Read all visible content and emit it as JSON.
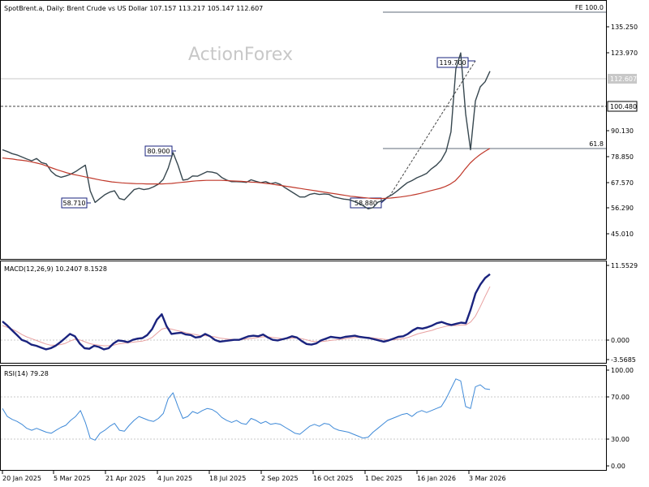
{
  "header": {
    "symbol": "SpotBrent.a",
    "timeframe": "Daily",
    "description": "Brent Crude vs US Dollar",
    "ohlc": "107.157 113.217 105.147 112.607"
  },
  "watermark": "ActionForex",
  "colors": {
    "price": "#37474f",
    "ma": "#c0392b",
    "macd": "#1a237e",
    "signal": "#e8a0a0",
    "rsi": "#3f8ad8",
    "fibo": "#5f6b7a",
    "grid": "#c8c8c8",
    "border": "#000000"
  },
  "chart_data": [
    {
      "type": "line",
      "panel": "price",
      "ylim": [
        39.5,
        140.0
      ],
      "yticks": [
        "135.250",
        "123.970",
        "112.607",
        "100.480",
        "90.130",
        "78.850",
        "67.570",
        "56.290",
        "45.010"
      ],
      "series": [
        {
          "values": [
            82.0,
            81.3,
            80.5,
            80.0,
            79.2,
            78.4,
            77.7,
            78.6,
            77.0,
            76.5,
            73.6,
            72.0,
            71.3,
            71.8,
            72.5,
            73.5,
            74.8,
            76.0,
            66.0,
            61.5,
            63.0,
            64.5,
            65.5,
            66.0,
            63.0,
            62.5,
            64.5,
            66.5,
            67.0,
            66.5,
            66.8,
            67.6,
            68.6,
            70.5,
            74.8,
            80.9,
            76.0,
            70.2,
            70.5,
            71.8,
            71.7,
            72.6,
            73.5,
            73.3,
            72.8,
            71.2,
            70.2,
            69.6,
            69.6,
            69.5,
            69.3,
            70.3,
            69.7,
            69.2,
            69.6,
            68.8,
            69.2,
            68.5,
            67.2,
            66.0,
            64.8,
            63.6,
            63.6,
            64.6,
            65.0,
            64.6,
            64.8,
            64.6,
            63.6,
            63.2,
            62.8,
            62.6,
            62.0,
            61.2,
            60.2,
            59.0,
            59.5,
            61.6,
            62.2,
            63.6,
            64.6,
            66.0,
            67.6,
            69.1,
            70.0,
            71.1,
            71.9,
            72.8,
            74.6,
            76.0,
            78.0,
            81.4,
            89.0,
            113.5,
            119.7,
            96.0,
            82.0,
            101.0,
            106.5,
            108.5,
            112.607
          ]
        },
        {
          "name": "MA",
          "values": [
            78.8,
            78.6,
            78.4,
            78.1,
            77.9,
            77.6,
            77.2,
            76.8,
            76.3,
            75.6,
            74.9,
            74.2,
            73.6,
            73.0,
            72.5,
            72.1,
            71.7,
            71.3,
            70.9,
            70.5,
            70.1,
            69.8,
            69.5,
            69.3,
            69.1,
            69.0,
            68.9,
            68.8,
            68.8,
            68.7,
            68.7,
            68.7,
            68.7,
            68.8,
            68.9,
            69.1,
            69.3,
            69.5,
            69.7,
            69.9,
            70.0,
            70.1,
            70.1,
            70.1,
            70.1,
            70.0,
            69.9,
            69.8,
            69.7,
            69.6,
            69.4,
            69.3,
            69.1,
            68.9,
            68.7,
            68.4,
            68.1,
            67.8,
            67.5,
            67.2,
            66.9,
            66.6,
            66.3,
            66.0,
            65.7,
            65.4,
            65.1,
            64.8,
            64.5,
            64.2,
            63.9,
            63.7,
            63.5,
            63.3,
            63.1,
            63.0,
            63.0,
            63.1,
            63.2,
            63.4,
            63.6,
            63.9,
            64.2,
            64.6,
            65.0,
            65.5,
            66.0,
            66.5,
            67.0,
            67.7,
            68.6,
            69.9,
            72.0,
            74.5,
            76.8,
            78.6,
            80.1,
            81.4,
            82.5
          ]
        }
      ]
    },
    {
      "type": "line",
      "panel": "macd",
      "title": "MACD(12,26,9) 10.2407 8.1528",
      "ylim": [
        -4.8,
        12.4
      ],
      "yticks": [
        "11.5529",
        "0.000",
        "-3.5685"
      ],
      "series": [
        {
          "values": [
            2.3,
            1.6,
            0.8,
            0.0,
            -0.8,
            -1.1,
            -1.6,
            -1.8,
            -2.1,
            -2.4,
            -2.2,
            -1.8,
            -1.2,
            -0.5,
            0.2,
            -0.2,
            -1.4,
            -2.2,
            -2.3,
            -1.8,
            -2.0,
            -2.4,
            -2.2,
            -1.4,
            -0.9,
            -1.0,
            -1.2,
            -0.8,
            -0.6,
            -0.5,
            0.0,
            1.0,
            2.6,
            3.5,
            1.5,
            0.2,
            0.3,
            0.4,
            0.1,
            0.0,
            -0.4,
            -0.3,
            0.2,
            -0.2,
            -0.8,
            -1.1,
            -1.0,
            -0.9,
            -0.8,
            -0.8,
            -0.5,
            -0.2,
            -0.1,
            -0.2,
            0.1,
            -0.4,
            -0.8,
            -0.9,
            -0.7,
            -0.5,
            -0.2,
            -0.4,
            -1.0,
            -1.5,
            -1.6,
            -1.4,
            -0.9,
            -0.6,
            -0.3,
            -0.4,
            -0.5,
            -0.3,
            -0.2,
            -0.1,
            -0.3,
            -0.4,
            -0.5,
            -0.7,
            -0.9,
            -1.1,
            -0.9,
            -0.6,
            -0.3,
            -0.2,
            0.2,
            0.8,
            1.2,
            1.1,
            1.3,
            1.6,
            2.0,
            2.2,
            1.9,
            1.7,
            1.9,
            2.1,
            2.0,
            4.3,
            7.0,
            8.5,
            9.6,
            10.24
          ]
        },
        {
          "values": [
            1.6,
            1.3,
            1.0,
            0.6,
            0.1,
            -0.3,
            -0.6,
            -0.9,
            -1.2,
            -1.5,
            -1.7,
            -1.7,
            -1.6,
            -1.4,
            -1.0,
            -0.7,
            -0.8,
            -1.1,
            -1.4,
            -1.6,
            -1.7,
            -1.8,
            -1.8,
            -1.7,
            -1.5,
            -1.4,
            -1.3,
            -1.2,
            -1.1,
            -1.0,
            -0.8,
            -0.4,
            0.3,
            1.0,
            1.2,
            1.0,
            0.8,
            0.6,
            0.4,
            0.2,
            0.1,
            -0.1,
            -0.1,
            -0.2,
            -0.3,
            -0.5,
            -0.6,
            -0.7,
            -0.7,
            -0.8,
            -0.7,
            -0.6,
            -0.5,
            -0.4,
            -0.3,
            -0.3,
            -0.4,
            -0.5,
            -0.6,
            -0.6,
            -0.5,
            -0.5,
            -0.6,
            -0.8,
            -1.0,
            -1.1,
            -1.1,
            -1.0,
            -0.9,
            -0.8,
            -0.7,
            -0.6,
            -0.5,
            -0.4,
            -0.4,
            -0.4,
            -0.4,
            -0.5,
            -0.6,
            -0.7,
            -0.8,
            -0.8,
            -0.7,
            -0.6,
            -0.4,
            -0.1,
            0.2,
            0.4,
            0.6,
            0.8,
            1.1,
            1.3,
            1.5,
            1.6,
            1.6,
            1.7,
            1.7,
            2.2,
            3.2,
            4.8,
            6.5,
            8.15
          ]
        }
      ]
    },
    {
      "type": "line",
      "panel": "rsi",
      "title": "RSI(14) 79.28",
      "ylim": [
        -3,
        103
      ],
      "yticks": [
        "100.00",
        "70.00",
        "30.00",
        "0.00"
      ],
      "series": [
        {
          "values": [
            60,
            52,
            49,
            47,
            44,
            40,
            38,
            40,
            38,
            36,
            35,
            38,
            41,
            43,
            48,
            52,
            58,
            46,
            30,
            28,
            35,
            38,
            42,
            45,
            38,
            37,
            43,
            48,
            52,
            50,
            48,
            47,
            50,
            55,
            70,
            76,
            62,
            50,
            52,
            57,
            55,
            58,
            60,
            59,
            56,
            51,
            48,
            46,
            48,
            45,
            44,
            50,
            48,
            45,
            47,
            44,
            45,
            44,
            41,
            38,
            35,
            34,
            38,
            42,
            44,
            42,
            45,
            44,
            40,
            38,
            37,
            36,
            34,
            32,
            30,
            31,
            36,
            40,
            44,
            48,
            50,
            52,
            54,
            55,
            52,
            56,
            58,
            56,
            58,
            60,
            62,
            70,
            80,
            90,
            88,
            62,
            60,
            82,
            84,
            80,
            79.28
          ]
        }
      ]
    }
  ],
  "price_scale": {
    "labels": [
      "135.250",
      "123.970",
      "112.607",
      "100.480",
      "90.130",
      "78.850",
      "67.570",
      "56.290",
      "45.010"
    ]
  },
  "macd_scale": {
    "labels": [
      "11.5529",
      "0.000",
      "-3.5685"
    ]
  },
  "rsi_scale": {
    "labels": [
      "100.00",
      "70.00",
      "30.00",
      "0.00"
    ]
  },
  "annotations": {
    "fe": "FE 100.0",
    "fib": "61.8",
    "high_callout": "119.700",
    "low_callout": "58.880",
    "mid_high_callout": "80.900",
    "mid_low_callout": "58.710",
    "current_price": "112.607",
    "level_price": "100.480"
  },
  "x_axis": {
    "labels": [
      "20 Jan 2025",
      "5 Mar 2025",
      "21 Apr 2025",
      "4 Jun 2025",
      "18 Jul 2025",
      "2 Sep 2025",
      "16 Oct 2025",
      "1 Dec 2025",
      "16 Jan 2026",
      "3 Mar 2026"
    ]
  }
}
